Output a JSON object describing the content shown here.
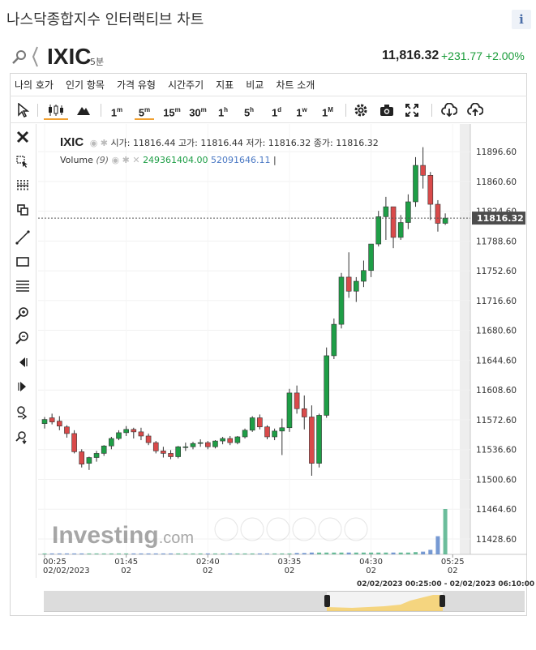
{
  "page": {
    "title": "나스닥종합지수 인터랙티브 차트",
    "info_label": "i"
  },
  "symbol": {
    "name": "IXIC",
    "timeframe": "5분",
    "price": "11,816.32",
    "change": "+231.77",
    "change_pct": "+2.00%"
  },
  "menu": [
    "나의 호가",
    "인기 항목",
    "가격 유형",
    "시간주기",
    "지표",
    "비교",
    "차트 소개"
  ],
  "toolbar": {
    "chart_types": [
      "candles",
      "mountain"
    ],
    "intervals": [
      {
        "base": "1",
        "sup": "m"
      },
      {
        "base": "5",
        "sup": "m"
      },
      {
        "base": "15",
        "sup": "m"
      },
      {
        "base": "30",
        "sup": "m"
      },
      {
        "base": "1",
        "sup": "h"
      },
      {
        "base": "5",
        "sup": "h"
      },
      {
        "base": "1",
        "sup": "d"
      },
      {
        "base": "1",
        "sup": "w"
      },
      {
        "base": "1",
        "sup": "M"
      }
    ],
    "selected_interval": "5m",
    "actions": [
      "gear-icon",
      "camera-icon",
      "fullscreen-icon",
      "download-icon",
      "upload-icon"
    ]
  },
  "left_tools": [
    "close-icon",
    "cursor-cross-icon",
    "magnet-icon",
    "copy-icon",
    "trendline-icon",
    "rectangle-icon",
    "fib-icon",
    "zoom-in-icon",
    "zoom-out-icon",
    "scroll-left-icon",
    "scroll-right-icon",
    "hand-icon",
    "reset-icon"
  ],
  "legend": {
    "symbol": "IXIC",
    "ohlc": "시가: 11816.44 고가: 11816.44 저가: 11816.32 종가: 11816.32",
    "volume_label": "Volume",
    "volume_param": "(9)",
    "volume_value_1": "249361404.00",
    "volume_value_2": "52091646.11",
    "volume_sep": "|"
  },
  "watermark": {
    "brand": "Investing",
    "suffix": ".com"
  },
  "navigator": {
    "range_label": "02/02/2023 00:25:00 - 02/02/2023 06:10:00"
  },
  "colors": {
    "up": "#1e9e46",
    "down": "#d94a4a",
    "volume": "#3aa77a",
    "accent": "#f0a030",
    "axis_text": "#333333"
  },
  "chart_data": {
    "type": "candlestick",
    "title": "IXIC",
    "interval": "5m",
    "ylim": [
      11410,
      11930
    ],
    "yticks": [
      11428.6,
      11464.6,
      11500.6,
      11536.6,
      11572.6,
      11608.6,
      11644.6,
      11680.6,
      11716.6,
      11752.6,
      11788.6,
      11824.6,
      11860.6,
      11896.6
    ],
    "ytick_labels": [
      "11428.60",
      "11464.60",
      "11500.60",
      "11536.60",
      "11572.60",
      "11608.60",
      "11644.60",
      "11680.60",
      "11716.60",
      "11752.60",
      "11788.60",
      "11824.60",
      "11860.60",
      "11896.60"
    ],
    "current_price": 11816.32,
    "current_price_label": "11816.32",
    "xticks": [
      {
        "bar": 0,
        "time": "00:25",
        "date": "02/02/2023"
      },
      {
        "bar": 11,
        "time": "01:45",
        "date": "02"
      },
      {
        "bar": 22,
        "time": "02:40",
        "date": "02"
      },
      {
        "bar": 33,
        "time": "03:35",
        "date": "02"
      },
      {
        "bar": 44,
        "time": "04:30",
        "date": "02"
      },
      {
        "bar": 55,
        "time": "05:25",
        "date": "02"
      }
    ],
    "candles": [
      [
        11568,
        11576,
        11562,
        11573
      ],
      [
        11575,
        11580,
        11567,
        11570
      ],
      [
        11571,
        11577,
        11560,
        11565
      ],
      [
        11564,
        11566,
        11551,
        11556
      ],
      [
        11556,
        11560,
        11532,
        11534
      ],
      [
        11534,
        11537,
        11515,
        11519
      ],
      [
        11520,
        11528,
        11512,
        11527
      ],
      [
        11527,
        11535,
        11522,
        11532
      ],
      [
        11532,
        11542,
        11529,
        11541
      ],
      [
        11541,
        11552,
        11537,
        11550
      ],
      [
        11550,
        11560,
        11548,
        11557
      ],
      [
        11557,
        11565,
        11553,
        11561
      ],
      [
        11561,
        11563,
        11550,
        11558
      ],
      [
        11558,
        11563,
        11548,
        11553
      ],
      [
        11553,
        11556,
        11542,
        11545
      ],
      [
        11545,
        11547,
        11532,
        11535
      ],
      [
        11535,
        11540,
        11527,
        11532
      ],
      [
        11532,
        11536,
        11525,
        11528
      ],
      [
        11528,
        11541,
        11526,
        11540
      ],
      [
        11540,
        11545,
        11535,
        11540
      ],
      [
        11540,
        11546,
        11537,
        11544
      ],
      [
        11544,
        11549,
        11540,
        11545
      ],
      [
        11545,
        11547,
        11537,
        11540
      ],
      [
        11540,
        11548,
        11538,
        11547
      ],
      [
        11547,
        11552,
        11543,
        11550
      ],
      [
        11550,
        11553,
        11542,
        11545
      ],
      [
        11545,
        11553,
        11543,
        11552
      ],
      [
        11552,
        11562,
        11550,
        11560
      ],
      [
        11560,
        11577,
        11558,
        11575
      ],
      [
        11575,
        11579,
        11561,
        11564
      ],
      [
        11564,
        11566,
        11549,
        11552
      ],
      [
        11552,
        11562,
        11548,
        11559
      ],
      [
        11559,
        11574,
        11530,
        11563
      ],
      [
        11563,
        11610,
        11558,
        11605
      ],
      [
        11605,
        11614,
        11580,
        11586
      ],
      [
        11586,
        11602,
        11561,
        11576
      ],
      [
        11576,
        11590,
        11505,
        11520
      ],
      [
        11520,
        11580,
        11515,
        11578
      ],
      [
        11578,
        11660,
        11575,
        11650
      ],
      [
        11650,
        11695,
        11646,
        11688
      ],
      [
        11688,
        11750,
        11683,
        11745
      ],
      [
        11745,
        11775,
        11720,
        11728
      ],
      [
        11728,
        11745,
        11715,
        11740
      ],
      [
        11740,
        11765,
        11733,
        11753
      ],
      [
        11753,
        11775,
        11745,
        11785
      ],
      [
        11785,
        11825,
        11782,
        11818
      ],
      [
        11818,
        11842,
        11790,
        11830
      ],
      [
        11830,
        11830,
        11780,
        11793
      ],
      [
        11793,
        11820,
        11790,
        11811
      ],
      [
        11811,
        11845,
        11803,
        11836
      ],
      [
        11836,
        11890,
        11830,
        11880
      ],
      [
        11880,
        11902,
        11852,
        11868
      ],
      [
        11868,
        11872,
        11814,
        11833
      ],
      [
        11833,
        11838,
        11800,
        11810
      ],
      [
        11810,
        11822,
        11808,
        11816.32
      ]
    ],
    "volume": [
      2,
      2,
      2,
      2,
      2,
      2,
      2,
      2,
      2,
      2,
      2,
      2,
      2,
      2,
      2,
      2,
      2,
      2,
      2,
      2,
      2,
      2,
      2,
      2,
      2,
      2,
      2,
      2,
      2,
      2,
      2,
      2,
      2,
      2,
      3,
      3,
      4,
      4,
      4,
      4,
      4,
      4,
      4,
      4,
      4,
      4,
      4,
      4,
      4,
      4,
      5,
      6,
      10,
      40,
      100
    ],
    "navigator_range": [
      "02/02/2023 00:25:00",
      "02/02/2023 06:10:00"
    ]
  }
}
